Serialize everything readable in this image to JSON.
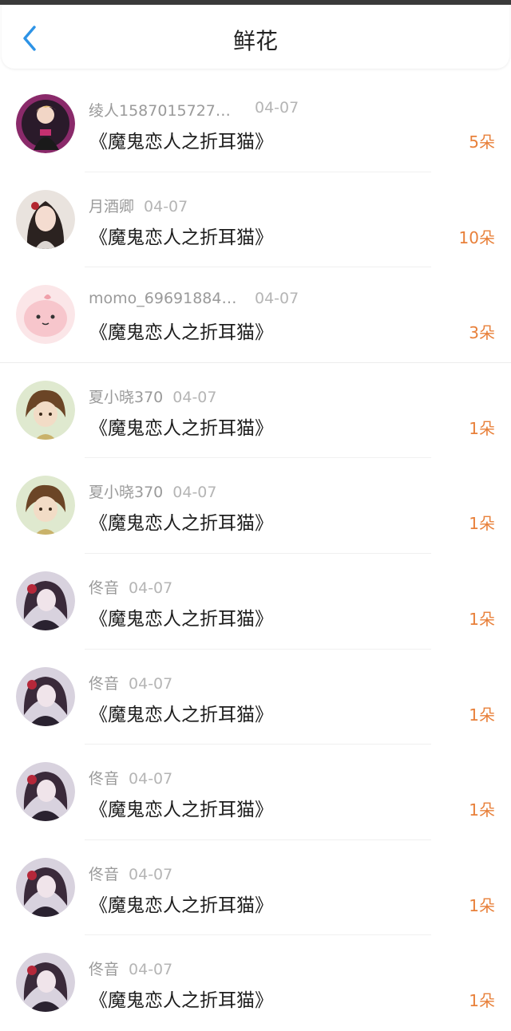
{
  "header": {
    "title": "鲜花",
    "back_icon": "chevron-left-icon"
  },
  "accent_color": "#e8803a",
  "items": [
    {
      "name": "绫人1587015727…",
      "date": "04-07",
      "book": "《魔鬼恋人之折耳猫》",
      "count": "5朵",
      "avatar": "anime-boy-avatar"
    },
    {
      "name": "月酒卿",
      "date": "04-07",
      "book": "《魔鬼恋人之折耳猫》",
      "count": "10朵",
      "avatar": "girl-photo-avatar"
    },
    {
      "name": "momo_69691884…",
      "date": "04-07",
      "book": "《魔鬼恋人之折耳猫》",
      "count": "3朵",
      "avatar": "pink-cartoon-avatar"
    },
    {
      "name": "夏小晓370",
      "date": "04-07",
      "book": "《魔鬼恋人之折耳猫》",
      "count": "1朵",
      "avatar": "anime-girl-avatar"
    },
    {
      "name": "夏小晓370",
      "date": "04-07",
      "book": "《魔鬼恋人之折耳猫》",
      "count": "1朵",
      "avatar": "anime-girl-avatar"
    },
    {
      "name": "佟音",
      "date": "04-07",
      "book": "《魔鬼恋人之折耳猫》",
      "count": "1朵",
      "avatar": "gothic-girl-avatar"
    },
    {
      "name": "佟音",
      "date": "04-07",
      "book": "《魔鬼恋人之折耳猫》",
      "count": "1朵",
      "avatar": "gothic-girl-avatar"
    },
    {
      "name": "佟音",
      "date": "04-07",
      "book": "《魔鬼恋人之折耳猫》",
      "count": "1朵",
      "avatar": "gothic-girl-avatar"
    },
    {
      "name": "佟音",
      "date": "04-07",
      "book": "《魔鬼恋人之折耳猫》",
      "count": "1朵",
      "avatar": "gothic-girl-avatar"
    },
    {
      "name": "佟音",
      "date": "04-07",
      "book": "《魔鬼恋人之折耳猫》",
      "count": "1朵",
      "avatar": "gothic-girl-avatar"
    }
  ]
}
